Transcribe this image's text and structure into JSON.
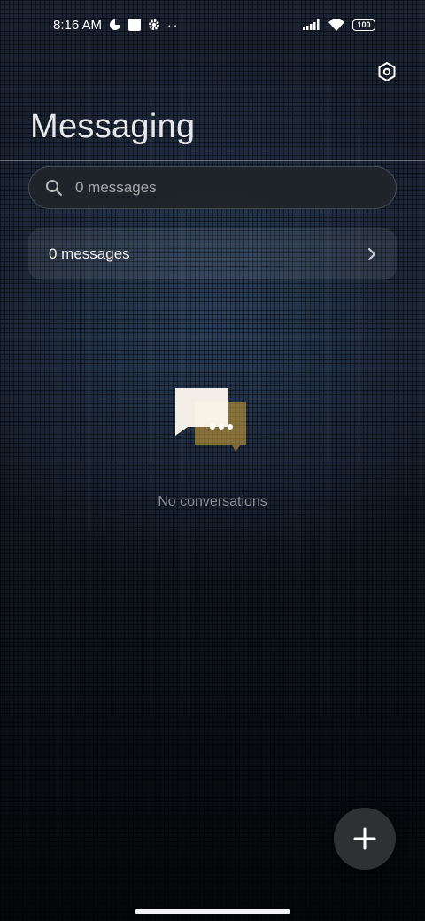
{
  "status_bar": {
    "time": "8:16 AM",
    "overflow_dots": "··",
    "battery": "100"
  },
  "header": {
    "title": "Messaging"
  },
  "search": {
    "placeholder": "0 messages"
  },
  "summary": {
    "label": "0 messages"
  },
  "empty_state": {
    "text": "No conversations"
  },
  "icons": {
    "settings": "settings-hexagon-icon",
    "search": "search-icon",
    "chevron": "chevron-right-icon",
    "empty": "chat-bubbles-icon",
    "add": "plus-icon"
  },
  "colors": {
    "bubble_front": "#fffaf0",
    "bubble_back": "#d9a93a"
  }
}
